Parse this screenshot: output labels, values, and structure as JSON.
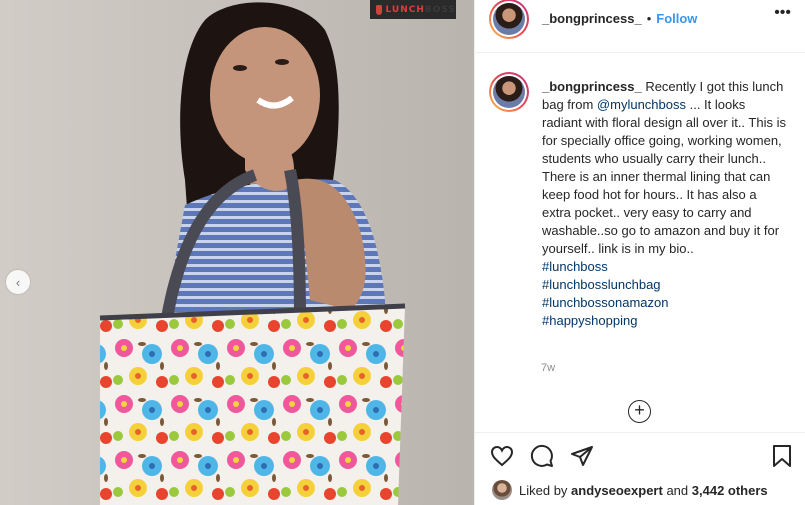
{
  "post": {
    "brand_watermark_1": "LUNCH",
    "brand_watermark_2": "BOSS",
    "carousel_prev_symbol": "‹"
  },
  "header": {
    "username": "_bongprincess_",
    "separator": "•",
    "follow_label": "Follow",
    "more_symbol": "•••"
  },
  "caption": {
    "username": "_bongprincess_",
    "text_1": " Recently I got this lunch bag from ",
    "mention": "@mylunchboss",
    "text_2": " ... It looks radiant with floral design all over it.. This is for specially office going, working women, students who usually carry their lunch.. There is an inner thermal lining that can keep food hot for hours.. It has also a extra pocket.. very easy to carry and washable..so go to amazon and buy it for yourself.. link is in my bio..",
    "hashtags": [
      "#lunchboss",
      "#lunchbosslunchbag",
      "#lunchbossonamazon",
      "#happyshopping"
    ],
    "time": "7w"
  },
  "add_comment_symbol": "+",
  "actions": {
    "icons": [
      "heart-icon",
      "comment-icon",
      "share-icon",
      "bookmark-icon"
    ]
  },
  "likes": {
    "prefix": "Liked by ",
    "user": "andyseoexpert",
    "middle": " and ",
    "count": "3,442 others"
  },
  "colors": {
    "link_blue": "#3897f0",
    "hashtag": "#00376b",
    "muted": "#8e8e8e",
    "text": "#262626"
  }
}
